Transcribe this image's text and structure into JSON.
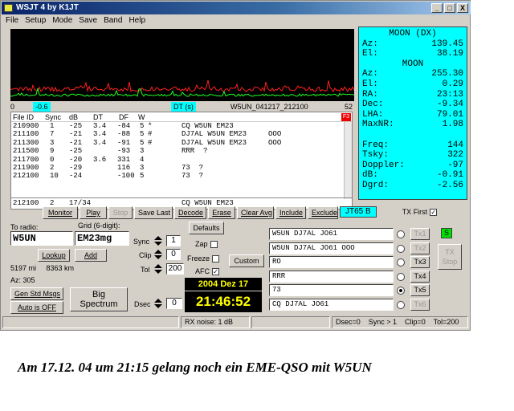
{
  "window": {
    "title": "WSJT 4   by K1JT",
    "min": "_",
    "max": "□",
    "close": "X"
  },
  "menu": [
    "File",
    "Setup",
    "Mode",
    "Save",
    "Band",
    "Help"
  ],
  "scale": {
    "left": "0",
    "offset": "-0.6",
    "dt_label": "DT (s)",
    "file": "W5UN_041217_212100",
    "right": "52"
  },
  "list": {
    "headers": [
      "File ID",
      "Sync",
      "dB",
      "DT",
      "DF",
      "W"
    ],
    "rows": [
      {
        "id": "210900",
        "sync": "1",
        "db": "-25",
        "dt": "3.4",
        "df": "-84",
        "w": "5",
        "flag": "*",
        "text": "CQ W5UN EM23"
      },
      {
        "id": "211100",
        "sync": "7",
        "db": "-21",
        "dt": "3.4",
        "df": "-88",
        "w": "5",
        "flag": "#",
        "text": "DJ7AL W5UN EM23     OOO"
      },
      {
        "id": "211300",
        "sync": "3",
        "db": "-21",
        "dt": "3.4",
        "df": "-91",
        "w": "5",
        "flag": "#",
        "text": "DJ7AL W5UN EM23     OOO"
      },
      {
        "id": "211500",
        "sync": "9",
        "db": "-25",
        "dt": "",
        "df": "-93",
        "w": "3",
        "flag": "",
        "text": "RRR  ?"
      },
      {
        "id": "211700",
        "sync": "0",
        "db": "-20",
        "dt": "3.6",
        "df": "331",
        "w": "4",
        "flag": "",
        "text": ""
      },
      {
        "id": "211900",
        "sync": "2",
        "db": "-29",
        "dt": "",
        "df": "116",
        "w": "3",
        "flag": "",
        "text": "73  ?"
      },
      {
        "id": "212100",
        "sync": "10",
        "db": "-24",
        "dt": "",
        "df": "-100",
        "w": "5",
        "flag": "",
        "text": "73  ?"
      }
    ],
    "avg": {
      "id": "212100",
      "sync": "2",
      "db": "17/34",
      "text": "CQ W5UN EM23"
    },
    "red_badge": "F3"
  },
  "moon": {
    "dx_title": "MOON (DX)",
    "dx": [
      {
        "k": "Az:",
        "v": "139.45"
      },
      {
        "k": "El:",
        "v": "38.19"
      }
    ],
    "title": "MOON",
    "rows": [
      {
        "k": "Az:",
        "v": "255.30"
      },
      {
        "k": "El:",
        "v": "0.29"
      },
      {
        "k": "RA:",
        "v": "23:13"
      },
      {
        "k": "Dec:",
        "v": "-9.34"
      },
      {
        "k": "LHA:",
        "v": "79.01"
      },
      {
        "k": "MaxNR:",
        "v": "1.98"
      }
    ],
    "rows2": [
      {
        "k": "Freq:",
        "v": "144"
      },
      {
        "k": "Tsky:",
        "v": "322"
      },
      {
        "k": "Doppler:",
        "v": "-97"
      },
      {
        "k": "dB:",
        "v": "-0.91"
      },
      {
        "k": "Dgrd:",
        "v": "-2.56"
      }
    ]
  },
  "buttons": {
    "monitor": "Monitor",
    "play": "Play",
    "stop": "Stop",
    "save_last": "Save Last",
    "decode": "Decode",
    "erase": "Erase",
    "clear_avg": "Clear Avg",
    "include": "Include",
    "exclude": "Exclude",
    "mode": "JT65 B",
    "tx_first": "TX First",
    "defaults": "Defaults",
    "lookup": "Lookup",
    "add": "Add",
    "custom": "Custom",
    "gen_std": "Gen Std Msgs",
    "auto": "Auto is OFF",
    "big_spectrum_1": "Big",
    "big_spectrum_2": "Spectrum",
    "tx_stop_1": "TX",
    "tx_stop_2": "Stop"
  },
  "left": {
    "to_radio": "To radio:",
    "call": "W5UN",
    "grid_label": "Grid (6-digit):",
    "grid": "EM23mg",
    "dist": "5197 mi     8363 km",
    "az": "Az: 305"
  },
  "mid": {
    "sync_label": "Sync",
    "sync": "1",
    "clip_label": "Clip",
    "clip": "0",
    "tol_label": "Tol",
    "tol": "200",
    "dsec_label": "Dsec",
    "dsec": "0",
    "zap": "Zap",
    "freeze": "Freeze",
    "afc": "AFC"
  },
  "datetime": {
    "date": "2004 Dez 17",
    "time": "21:46:52"
  },
  "messages": [
    {
      "text": "W5UN DJ7AL JO61",
      "tx": "Tx1"
    },
    {
      "text": "W5UN DJ7AL JO61 OOO",
      "tx": "Tx2"
    },
    {
      "text": "RO",
      "tx": "Tx3"
    },
    {
      "text": "RRR",
      "tx": "Tx4"
    },
    {
      "text": "73",
      "tx": "Tx5"
    },
    {
      "text": "CQ DJ7AL JO61",
      "tx": "Tx6"
    }
  ],
  "green_badge": "S",
  "status": {
    "rx": "RX noise:  1 dB",
    "right": "Dsec=0    Sync > 1    Clip=0    Tol=200"
  },
  "caption": "Am 17.12. 04 um 21:15 gelang noch ein EME-QSO mit W5UN",
  "colors": {
    "cyan": "#00ffff",
    "title": "#0a246a",
    "spec_red": "#ff2020",
    "spec_green": "#20ff20"
  }
}
